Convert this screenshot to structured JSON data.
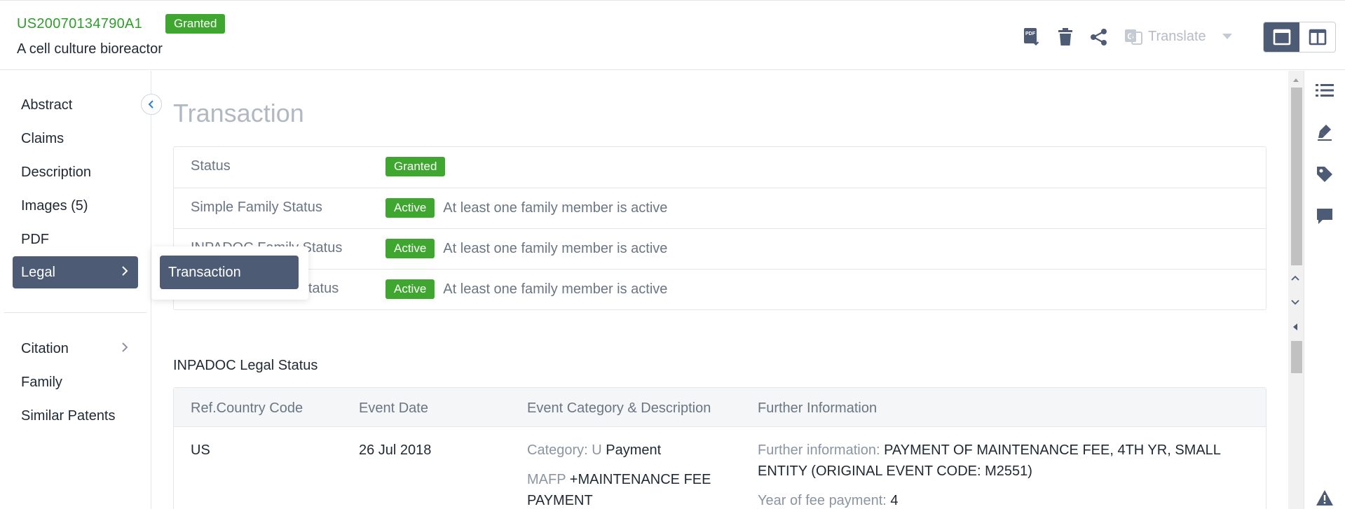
{
  "header": {
    "patent_number": "US20070134790A1",
    "status_badge": "Granted",
    "title": "A cell culture bioreactor",
    "translate_label": "Translate",
    "icons": [
      "pdf-download-icon",
      "delete-icon",
      "share-icon",
      "translate-icon",
      "single-pane-icon",
      "split-pane-icon"
    ]
  },
  "sidebar": {
    "items": [
      {
        "label": "Abstract"
      },
      {
        "label": "Claims"
      },
      {
        "label": "Description"
      },
      {
        "label": "Images (5)"
      },
      {
        "label": "PDF"
      },
      {
        "label": "Legal"
      }
    ],
    "items2": [
      {
        "label": "Citation"
      },
      {
        "label": "Family"
      },
      {
        "label": "Similar Patents"
      }
    ]
  },
  "flyout": {
    "item": "Transaction"
  },
  "main": {
    "section_title": "Transaction",
    "status_rows": [
      {
        "label": "Status",
        "badge": "Granted",
        "desc": ""
      },
      {
        "label": "Simple Family Status",
        "badge": "Active",
        "desc": "At least one family member is active"
      },
      {
        "label": "INPADOC Family Status",
        "badge": "Active",
        "desc": "At least one family member is active"
      },
      {
        "label": "Extended Family Status",
        "badge": "Active",
        "desc": "At least one family member is active"
      }
    ],
    "legal_title": "INPADOC Legal Status",
    "legal_headers": [
      "Ref.Country Code",
      "Event Date",
      "Event Category & Description",
      "Further Information"
    ],
    "legal_rows": [
      {
        "country": "US",
        "date": "26 Jul 2018",
        "category_label": "Category:",
        "category_code": "U",
        "category_value": "Payment",
        "event_code": "MAFP",
        "event_desc": "+MAINTENANCE FEE PAYMENT",
        "further_label": "Further information:",
        "further_value": "PAYMENT OF MAINTENANCE FEE, 4TH YR, SMALL ENTITY (ORIGINAL EVENT CODE: M2551)",
        "year_label": "Year of fee payment:",
        "year_value": "4"
      }
    ]
  },
  "colors": {
    "brand_green": "#3fa62f",
    "nav_active": "#4d5b74",
    "muted_text": "#6a7683"
  }
}
